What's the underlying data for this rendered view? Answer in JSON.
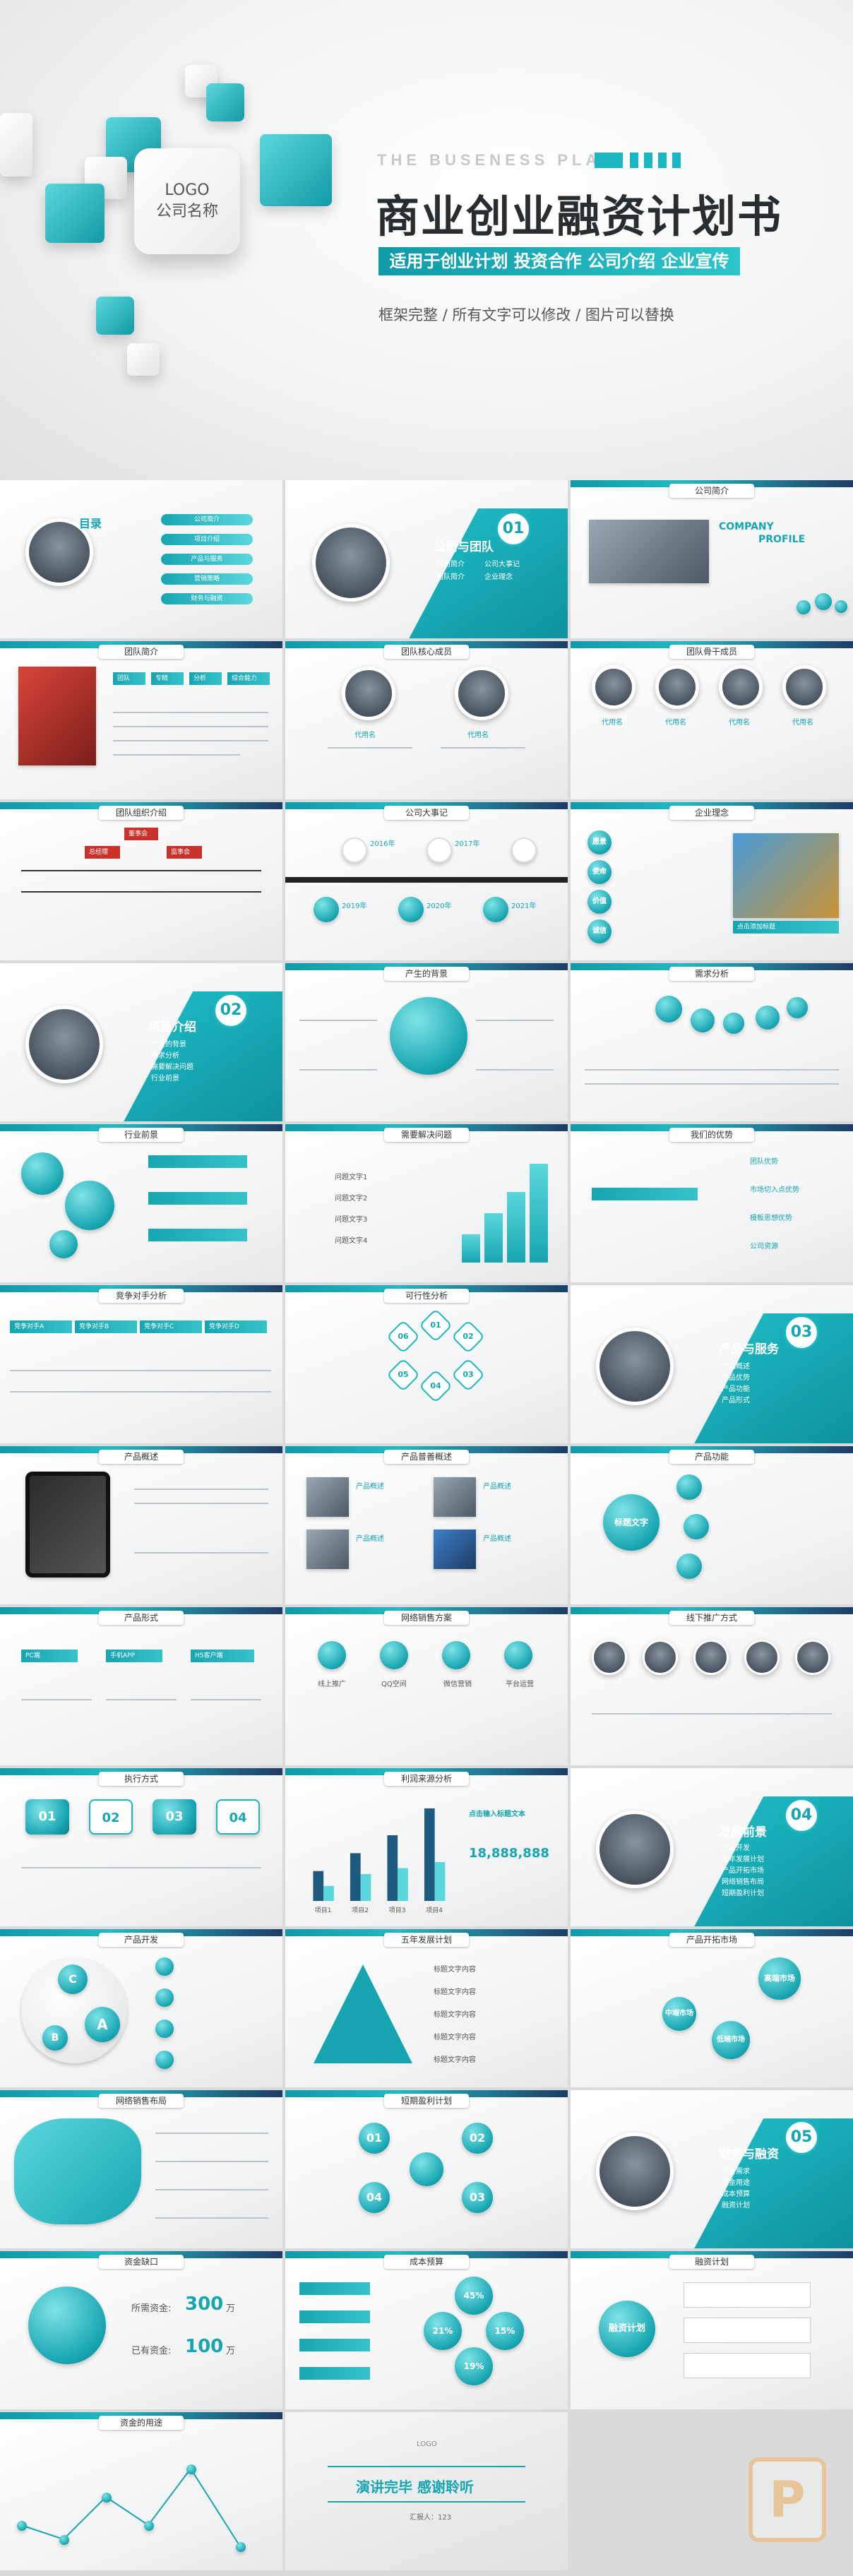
{
  "hero": {
    "logo_line1": "LOGO",
    "logo_line2": "公司名称",
    "kicker": "THE BUSENESS PLAN",
    "title": "商业创业融资计划书",
    "banner": "适用于创业计划  投资合作  公司介绍  企业宣传",
    "subtitle": "框架完整 / 所有文字可以修改 / 图片可以替换"
  },
  "colors": {
    "accent": "#17a5b1",
    "accent_light": "#5ad7dc",
    "navy": "#1e3c66"
  },
  "slides": {
    "s01": {
      "title": "目录",
      "items": [
        "公司简介",
        "项目介绍",
        "产品与服务",
        "营销策略",
        "财务与融资"
      ]
    },
    "s02": {
      "number": "01",
      "title": "公司与团队",
      "items": [
        "公司简介",
        "团队简介",
        "公司大事记",
        "企业理念"
      ]
    },
    "s03": {
      "title": "公司简介",
      "brand1": "COMPANY",
      "brand2": "PROFILE",
      "text": "公司简介"
    },
    "s04": {
      "title": "团队简介",
      "tags": [
        "团队",
        "专精",
        "分析",
        "综合能力"
      ]
    },
    "s05": {
      "title": "团队核心成员",
      "names": [
        "代用名",
        "代用名"
      ]
    },
    "s06": {
      "title": "团队骨干成员",
      "names": [
        "代用名",
        "代用名",
        "代用名",
        "代用名"
      ]
    },
    "s07": {
      "title": "团队组织介绍",
      "top": "董事会",
      "second": [
        "总经理",
        "监事会"
      ]
    },
    "s08": {
      "title": "公司大事记",
      "years": [
        "2016年",
        "2017年",
        "2018年",
        "2019年",
        "2020年",
        "2021年"
      ]
    },
    "s09": {
      "title": "企业理念",
      "items": [
        "愿景",
        "使命",
        "价值",
        "诚信"
      ],
      "caption": "点击添加标题"
    },
    "s10": {
      "number": "02",
      "title": "项目介绍",
      "items": [
        "产生的背景",
        "需求分析",
        "需要解决问题",
        "行业前景",
        "我们的优势",
        "竞争对手分析",
        "可行性分析"
      ]
    },
    "s11": {
      "title": "产生的背景"
    },
    "s12": {
      "title": "需求分析"
    },
    "s13": {
      "title": "行业前景"
    },
    "s14": {
      "title": "需要解决问题",
      "items": [
        "问题文字1",
        "问题文字2",
        "问题文字3",
        "问题文字4"
      ]
    },
    "s15": {
      "title": "我们的优势",
      "items": [
        "团队优势",
        "市场切入点优势",
        "模板思想优势",
        "公司资源"
      ]
    },
    "s16": {
      "title": "竞争对手分析",
      "items": [
        "竞争对手A",
        "竞争对手B",
        "竞争对手C",
        "竞争对手D"
      ]
    },
    "s17": {
      "title": "可行性分析",
      "hexes": [
        "01",
        "02",
        "03",
        "04",
        "05",
        "06"
      ]
    },
    "s18": {
      "number": "03",
      "title": "产品与服务",
      "items": [
        "产品概述",
        "产品优势",
        "产品功能",
        "产品形式"
      ]
    },
    "s19": {
      "title": "产品概述"
    },
    "s20": {
      "title": "产品普善概述",
      "items": [
        "产品概述",
        "产品概述",
        "产品概述",
        "产品概述"
      ]
    },
    "s21": {
      "title": "产品功能",
      "center": "标题文字"
    },
    "s22": {
      "title": "产品形式",
      "items": [
        "PC端",
        "手机APP",
        "H5客户端"
      ]
    },
    "s23": {
      "title": "网络销售方案",
      "items": [
        "线上推广",
        "QQ空间",
        "微信营销",
        "平台运营"
      ]
    },
    "s24": {
      "title": "线下推广方式"
    },
    "s25": {
      "title": "执行方式",
      "steps": [
        "01",
        "02",
        "03",
        "04"
      ]
    },
    "s26": {
      "title": "利润来源分析",
      "headline": "点击输入标题文本",
      "total": "18,888,888"
    },
    "s27": {
      "number": "04",
      "title": "发展前景",
      "items": [
        "产品开发",
        "五年发展计划",
        "产品开拓市场",
        "网络销售布局",
        "短期盈利计划"
      ]
    },
    "s28": {
      "title": "产品开发",
      "labels": [
        "C",
        "B",
        "A"
      ]
    },
    "s29": {
      "title": "五年发展计划",
      "items": [
        "标题文字内容",
        "标题文字内容",
        "标题文字内容",
        "标题文字内容",
        "标题文字内容"
      ]
    },
    "s30": {
      "title": "产品开拓市场",
      "items": [
        "高端市场",
        "中端市场",
        "低端市场"
      ]
    },
    "s31": {
      "title": "网络销售布局"
    },
    "s32": {
      "title": "短期盈利计划",
      "items": [
        "01",
        "02",
        "03",
        "04"
      ]
    },
    "s33": {
      "number": "05",
      "title": "财务与融资",
      "items": [
        "资金需求",
        "资金用途",
        "成本预算",
        "融资计划"
      ]
    },
    "s34": {
      "title": "资金缺口",
      "row1_label": "所需资金:",
      "row1_value": "300",
      "row2_label": "已有资金:",
      "row2_value": "100",
      "unit": "万"
    },
    "s35": {
      "title": "成本预算",
      "pcts": [
        "45%",
        "21%",
        "15%",
        "19%"
      ]
    },
    "s36": {
      "title": "融资计划",
      "center": "融资计划"
    },
    "s37": {
      "title": "资金的用途"
    },
    "s38": {
      "logo": "LOGO",
      "line": "演讲完毕  感谢聆听",
      "sub": "汇报人：123"
    }
  },
  "chart_data": {
    "type": "bar",
    "title": "点击输入标题文本",
    "categories": [
      "项目1",
      "项目2",
      "项目3",
      "项目4"
    ],
    "series": [
      {
        "values": [
          20,
          32,
          44,
          62
        ]
      },
      {
        "values": [
          10,
          18,
          22,
          26
        ]
      }
    ],
    "ylim": [
      0,
      70
    ]
  }
}
